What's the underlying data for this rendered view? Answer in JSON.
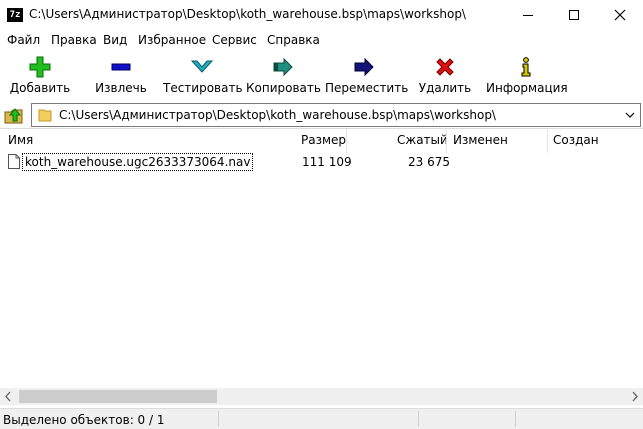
{
  "window": {
    "app_icon_text": "7z",
    "title": "C:\\Users\\Администратор\\Desktop\\koth_warehouse.bsp\\maps\\workshop\\"
  },
  "menu": [
    "Файл",
    "Правка",
    "Вид",
    "Избранное",
    "Сервис",
    "Справка"
  ],
  "toolbar": {
    "add": "Добавить",
    "extract": "Извлечь",
    "test": "Тестировать",
    "copy": "Копировать",
    "move": "Переместить",
    "delete": "Удалить",
    "info": "Информация"
  },
  "address": {
    "path": "C:\\Users\\Администратор\\Desktop\\koth_warehouse.bsp\\maps\\workshop\\"
  },
  "columns": {
    "name": "Имя",
    "size": "Размер",
    "packed": "Сжатый",
    "modified": "Изменен",
    "created": "Создан"
  },
  "files": [
    {
      "name": "koth_warehouse.ugc2633373064.nav",
      "size": "111 109",
      "packed": "23 675"
    }
  ],
  "status": {
    "selected": "Выделено объектов: 0 / 1"
  },
  "colors": {
    "add": "#1fbf1f",
    "extract": "#1010c8",
    "test": "#19b0c0",
    "copy": "#1f8f7f",
    "move": "#141478",
    "delete": "#e01010",
    "info": "#d8c800"
  }
}
